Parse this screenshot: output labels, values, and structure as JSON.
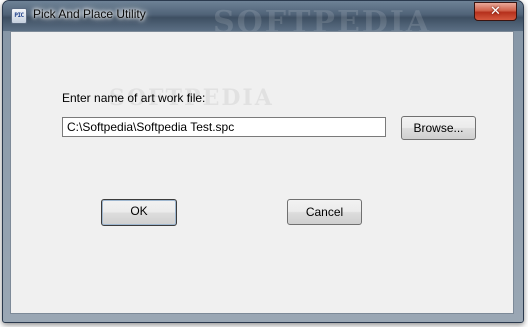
{
  "window": {
    "title": "Pick And Place Utility",
    "icon_text": "PIC",
    "icon": "app-icon",
    "close_label": "✕",
    "watermark": "SOFTPEDIA"
  },
  "form": {
    "prompt_label": "Enter name of art work file:",
    "file_path_value": "C:\\Softpedia\\Softpedia Test.spc",
    "browse_label": "Browse...",
    "ok_label": "OK",
    "cancel_label": "Cancel",
    "watermark": "SOFTPEDIA"
  },
  "colors": {
    "dialog_background": "#f0f0f0",
    "close_button": "#c7432a",
    "titlebar": "#4d6177"
  }
}
